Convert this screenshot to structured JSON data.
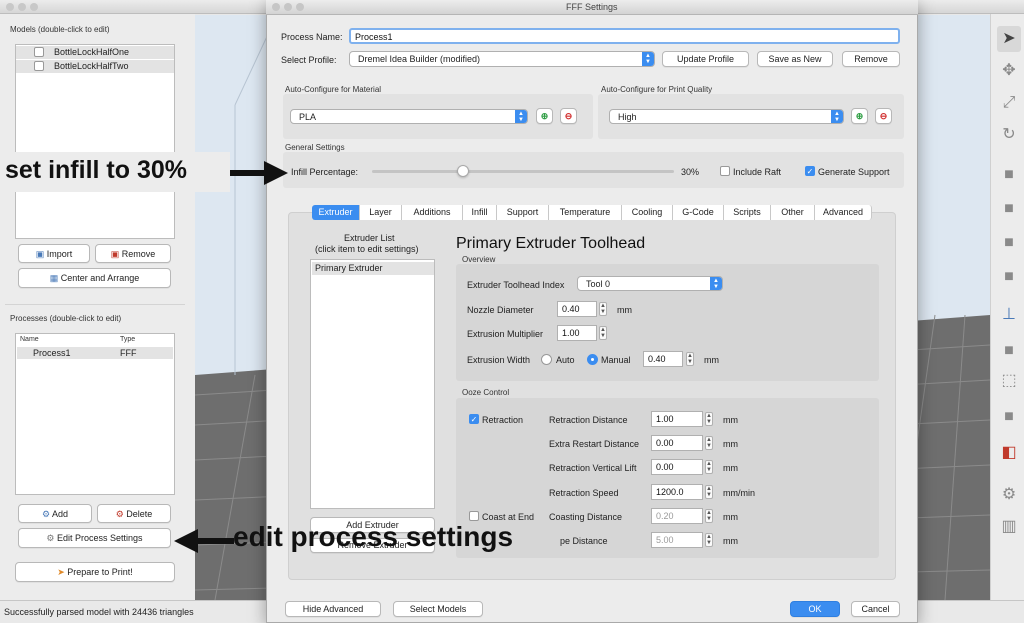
{
  "left_panel": {
    "models_label": "Models (double-click to edit)",
    "models": [
      "BottleLockHalfOne",
      "BottleLockHalfTwo"
    ],
    "import_label": "Import",
    "remove_label": "Remove",
    "center_arrange_label": "Center and Arrange",
    "processes_label": "Processes (double-click to edit)",
    "col_name": "Name",
    "col_type": "Type",
    "process_name": "Process1",
    "process_type": "FFF",
    "add_label": "Add",
    "delete_label": "Delete",
    "edit_process_label": "Edit Process Settings",
    "prepare_label": "Prepare to Print!"
  },
  "status_bar": "Successfully parsed model with 24436 triangles",
  "dialog": {
    "title": "FFF Settings",
    "process_name_label": "Process Name:",
    "process_name_value": "Process1",
    "select_profile_label": "Select Profile:",
    "profile_value": "Dremel Idea Builder (modified)",
    "update_profile": "Update Profile",
    "save_as_new": "Save as New",
    "remove": "Remove",
    "auto_material_label": "Auto-Configure for Material",
    "material_value": "PLA",
    "auto_quality_label": "Auto-Configure for Print Quality",
    "quality_value": "High",
    "general_settings_label": "General Settings",
    "infill_label": "Infill Percentage:",
    "infill_value_text": "30%",
    "infill_fraction": 0.3,
    "include_raft": "Include Raft",
    "generate_support": "Generate Support",
    "tabs": [
      "Extruder",
      "Layer",
      "Additions",
      "Infill",
      "Support",
      "Temperature",
      "Cooling",
      "G-Code",
      "Scripts",
      "Other",
      "Advanced"
    ],
    "extruder_list_title": "Extruder List",
    "extruder_list_hint": "(click item to edit settings)",
    "extruder_item": "Primary Extruder",
    "add_extruder": "Add Extruder",
    "remove_extruder": "Remove Extruder",
    "toolhead_title": "Primary Extruder Toolhead",
    "overview_label": "Overview",
    "toolhead_index_label": "Extruder Toolhead Index",
    "toolhead_index_value": "Tool 0",
    "nozzle_label": "Nozzle Diameter",
    "nozzle_value": "0.40",
    "nozzle_unit": "mm",
    "multiplier_label": "Extrusion Multiplier",
    "multiplier_value": "1.00",
    "width_label": "Extrusion Width",
    "auto_label": "Auto",
    "manual_label": "Manual",
    "width_value": "0.40",
    "width_unit": "mm",
    "ooze_label": "Ooze Control",
    "retraction_label": "Retraction",
    "retraction_distance_label": "Retraction Distance",
    "retraction_distance_value": "1.00",
    "extra_restart_label": "Extra Restart Distance",
    "extra_restart_value": "0.00",
    "vertical_lift_label": "Retraction Vertical Lift",
    "vertical_lift_value": "0.00",
    "retraction_speed_label": "Retraction Speed",
    "retraction_speed_value": "1200.0",
    "speed_unit": "mm/min",
    "mm": "mm",
    "coast_at_end": "Coast at End",
    "coasting_label": "Coasting Distance",
    "coasting_value": "0.20",
    "wipe_label_partial": "pe Distance",
    "wipe_value": "5.00",
    "hide_advanced": "Hide Advanced",
    "select_models": "Select Models",
    "ok": "OK",
    "cancel": "Cancel"
  },
  "annotations": {
    "infill": "set infill to 30%",
    "edit": "edit process settings"
  }
}
